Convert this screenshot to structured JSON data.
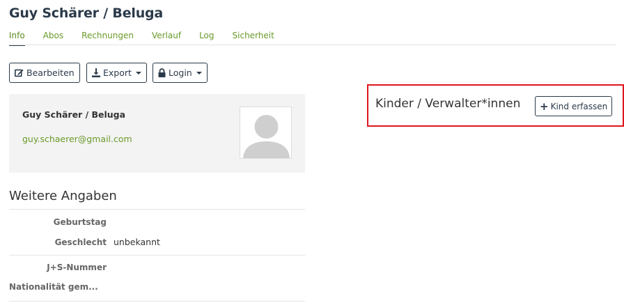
{
  "header": {
    "title": "Guy Schärer / Beluga"
  },
  "tabs": [
    {
      "label": "Info"
    },
    {
      "label": "Abos"
    },
    {
      "label": "Rechnungen"
    },
    {
      "label": "Verlauf"
    },
    {
      "label": "Log"
    },
    {
      "label": "Sicherheit"
    }
  ],
  "toolbar": {
    "edit_label": "Bearbeiten",
    "export_label": "Export",
    "login_label": "Login"
  },
  "person_card": {
    "name": "Guy Schärer / Beluga",
    "email": "guy.schaerer@gmail.com"
  },
  "details": {
    "section_title": "Weitere Angaben",
    "rows": [
      {
        "label": "Geburtstag",
        "value": ""
      },
      {
        "label": "Geschlecht",
        "value": "unbekannt"
      },
      {
        "label": "J+S-Nummer",
        "value": ""
      },
      {
        "label": "Nationalität gem...",
        "value": ""
      }
    ]
  },
  "kinder": {
    "title": "Kinder / Verwalter*innen",
    "add_label": "Kind erfassen"
  },
  "colors": {
    "link_green": "#6a9a2a",
    "dark_navy": "#2b3a4a",
    "highlight_red": "#e0141e",
    "card_bg": "#f3f3f3"
  }
}
